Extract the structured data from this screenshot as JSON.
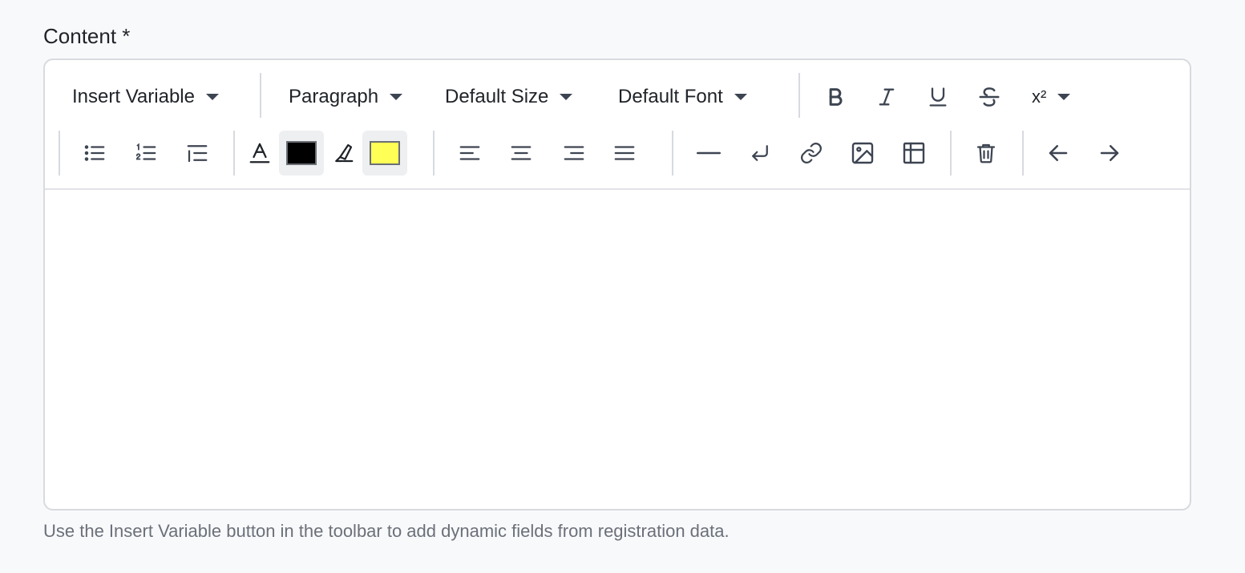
{
  "field": {
    "label": "Content *",
    "help_text": "Use the Insert Variable button in the toolbar to add dynamic fields from registration data."
  },
  "toolbar": {
    "insert_variable_label": "Insert Variable",
    "block_format_label": "Paragraph",
    "font_size_label": "Default Size",
    "font_family_label": "Default Font",
    "script_label": "x²",
    "text_color": "#000000",
    "highlight_color": "#ffff55"
  },
  "editor": {
    "content": ""
  }
}
